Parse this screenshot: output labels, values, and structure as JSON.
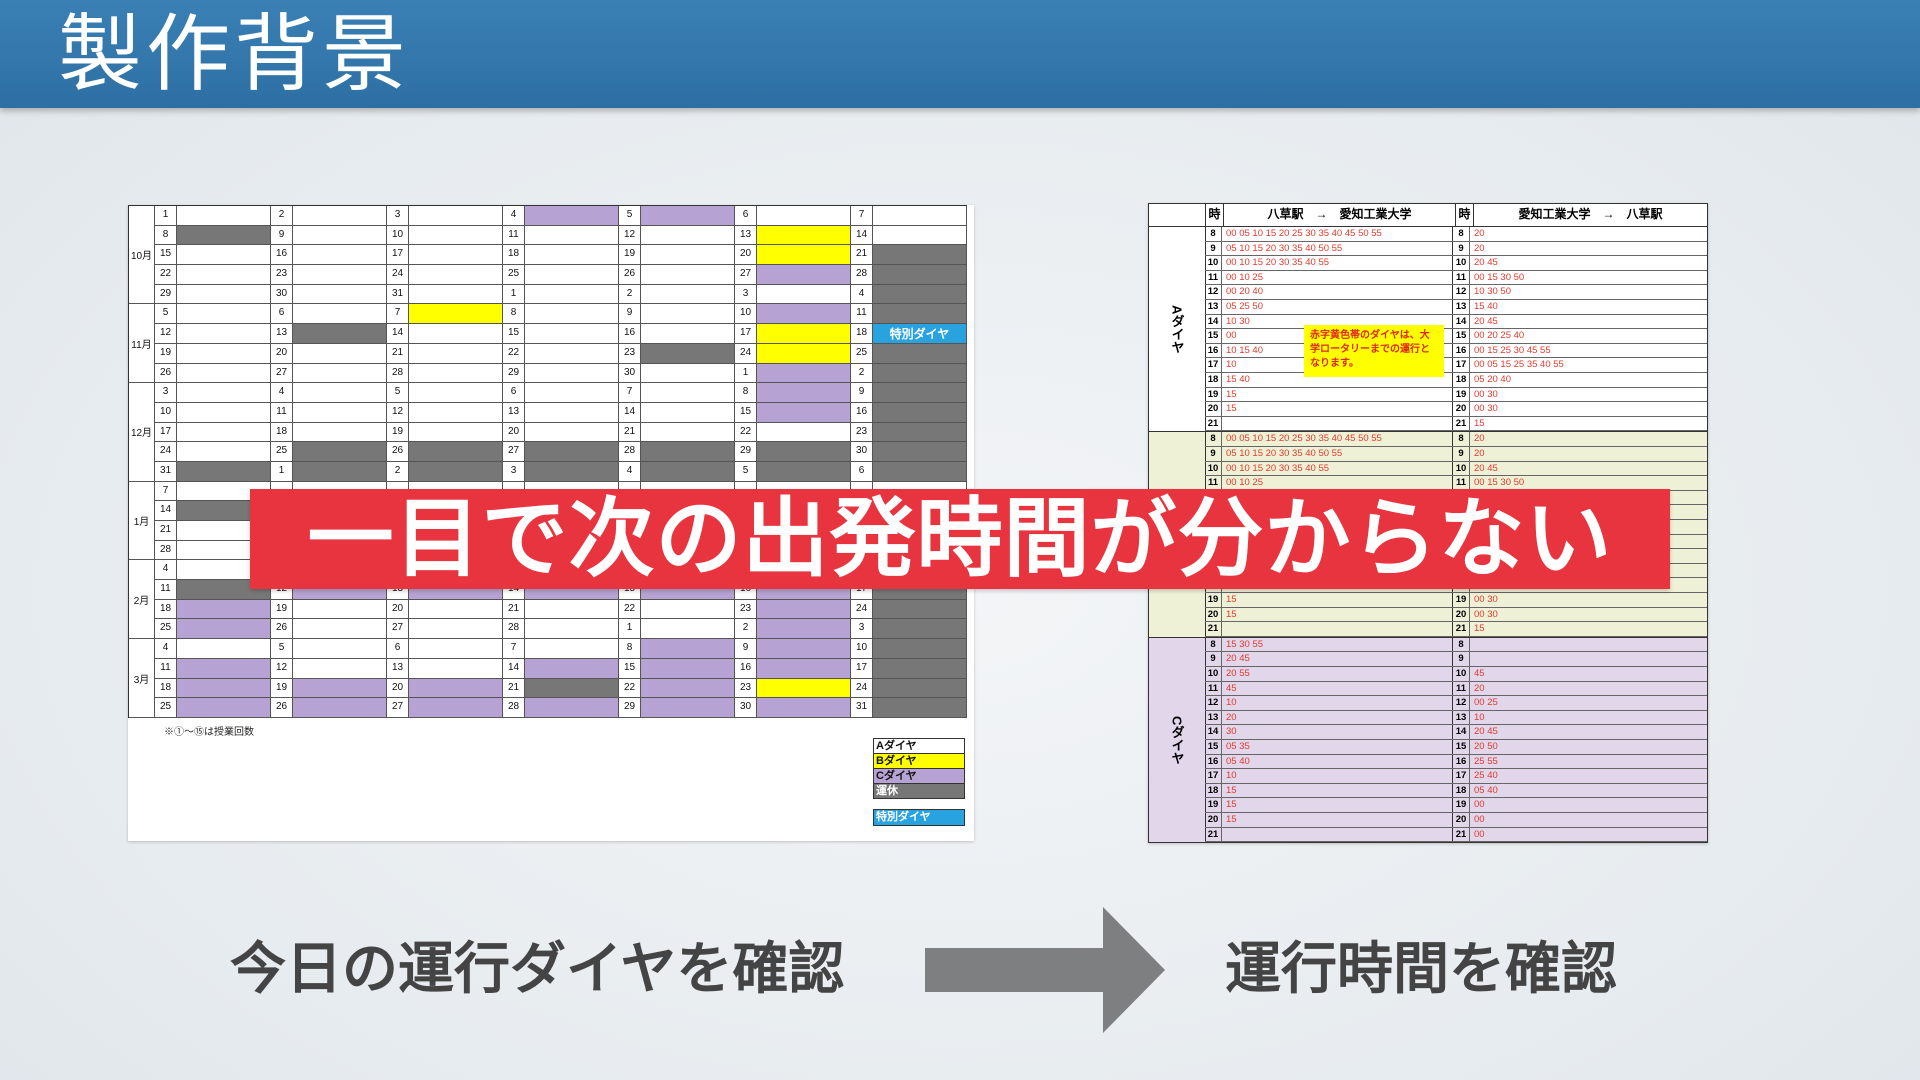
{
  "header": {
    "title": "製作背景"
  },
  "calendar": {
    "months": [
      {
        "label": "10月",
        "rows": [
          [
            [
              "1",
              "A"
            ],
            [
              "2",
              "A"
            ],
            [
              "3",
              "A"
            ],
            [
              "4",
              "C"
            ],
            [
              "5",
              "C"
            ],
            [
              "6",
              "A"
            ],
            [
              "7",
              "A"
            ]
          ],
          [
            [
              "8",
              "R"
            ],
            [
              "9",
              "A"
            ],
            [
              "10",
              "A"
            ],
            [
              "11",
              "A"
            ],
            [
              "12",
              "A"
            ],
            [
              "13",
              "B"
            ],
            [
              "14",
              "A"
            ]
          ],
          [
            [
              "15",
              "A"
            ],
            [
              "16",
              "A"
            ],
            [
              "17",
              "A"
            ],
            [
              "18",
              "A"
            ],
            [
              "19",
              "A"
            ],
            [
              "20",
              "B"
            ],
            [
              "21",
              "R"
            ]
          ],
          [
            [
              "22",
              "A"
            ],
            [
              "23",
              "A"
            ],
            [
              "24",
              "A"
            ],
            [
              "25",
              "A"
            ],
            [
              "26",
              "A"
            ],
            [
              "27",
              "C"
            ],
            [
              "28",
              "R"
            ]
          ],
          [
            [
              "29",
              "A"
            ],
            [
              "30",
              "A"
            ],
            [
              "31",
              "A"
            ],
            [
              "1",
              "A"
            ],
            [
              "2",
              "A"
            ],
            [
              "3",
              "A"
            ],
            [
              "4",
              "R"
            ]
          ]
        ]
      },
      {
        "label": "11月",
        "rows": [
          [
            [
              "5",
              "A"
            ],
            [
              "6",
              "A"
            ],
            [
              "7",
              "B"
            ],
            [
              "8",
              "A"
            ],
            [
              "9",
              "A"
            ],
            [
              "10",
              "C"
            ],
            [
              "11",
              "R"
            ]
          ],
          [
            [
              "12",
              "A"
            ],
            [
              "13",
              "R"
            ],
            [
              "14",
              "A"
            ],
            [
              "15",
              "A"
            ],
            [
              "16",
              "A"
            ],
            [
              "17",
              "B"
            ],
            [
              "18",
              "S"
            ]
          ],
          [
            [
              "19",
              "A"
            ],
            [
              "20",
              "A"
            ],
            [
              "21",
              "A"
            ],
            [
              "22",
              "A"
            ],
            [
              "23",
              "R"
            ],
            [
              "24",
              "B"
            ],
            [
              "25",
              "R"
            ]
          ],
          [
            [
              "26",
              "A"
            ],
            [
              "27",
              "A"
            ],
            [
              "28",
              "A"
            ],
            [
              "29",
              "A"
            ],
            [
              "30",
              "A"
            ],
            [
              "1",
              "C"
            ],
            [
              "2",
              "R"
            ]
          ]
        ]
      },
      {
        "label": "12月",
        "rows": [
          [
            [
              "3",
              "A"
            ],
            [
              "4",
              "A"
            ],
            [
              "5",
              "A"
            ],
            [
              "6",
              "A"
            ],
            [
              "7",
              "A"
            ],
            [
              "8",
              "C"
            ],
            [
              "9",
              "R"
            ]
          ],
          [
            [
              "10",
              "A"
            ],
            [
              "11",
              "A"
            ],
            [
              "12",
              "A"
            ],
            [
              "13",
              "A"
            ],
            [
              "14",
              "A"
            ],
            [
              "15",
              "C"
            ],
            [
              "16",
              "R"
            ]
          ],
          [
            [
              "17",
              "A"
            ],
            [
              "18",
              "A"
            ],
            [
              "19",
              "A"
            ],
            [
              "20",
              "A"
            ],
            [
              "21",
              "A"
            ],
            [
              "22",
              "A"
            ],
            [
              "23",
              "R"
            ]
          ],
          [
            [
              "24",
              "A"
            ],
            [
              "25",
              "R"
            ],
            [
              "26",
              "R"
            ],
            [
              "27",
              "R"
            ],
            [
              "28",
              "R"
            ],
            [
              "29",
              "R"
            ],
            [
              "30",
              "R"
            ]
          ],
          [
            [
              "31",
              "R"
            ],
            [
              "1",
              "R"
            ],
            [
              "2",
              "R"
            ],
            [
              "3",
              "R"
            ],
            [
              "4",
              "R"
            ],
            [
              "5",
              "R"
            ],
            [
              "6",
              "R"
            ]
          ]
        ]
      },
      {
        "label": "1月",
        "rows": [
          [
            [
              "7",
              "A"
            ],
            [
              "",
              "A"
            ],
            [
              "",
              "A"
            ],
            [
              "",
              "A"
            ],
            [
              "",
              "A"
            ],
            [
              "",
              "A"
            ],
            [
              "",
              "A"
            ]
          ],
          [
            [
              "14",
              "R"
            ],
            [
              "",
              "A"
            ],
            [
              "",
              "A"
            ],
            [
              "",
              "A"
            ],
            [
              "",
              "A"
            ],
            [
              "",
              "A"
            ],
            [
              "",
              "A"
            ]
          ],
          [
            [
              "21",
              "A"
            ],
            [
              "",
              "A"
            ],
            [
              "",
              "A"
            ],
            [
              "",
              "A"
            ],
            [
              "",
              "A"
            ],
            [
              "",
              "A"
            ],
            [
              "",
              "A"
            ]
          ],
          [
            [
              "28",
              "A"
            ],
            [
              "",
              "A"
            ],
            [
              "",
              "A"
            ],
            [
              "",
              "A"
            ],
            [
              "",
              "A"
            ],
            [
              "",
              "A"
            ],
            [
              "",
              "A"
            ]
          ]
        ]
      },
      {
        "label": "2月",
        "rows": [
          [
            [
              "4",
              "A"
            ],
            [
              "",
              "A"
            ],
            [
              "",
              "A"
            ],
            [
              "",
              "A"
            ],
            [
              "",
              "A"
            ],
            [
              "",
              "A"
            ],
            [
              "",
              "A"
            ]
          ],
          [
            [
              "11",
              "R"
            ],
            [
              "12",
              "C"
            ],
            [
              "13",
              "C"
            ],
            [
              "14",
              "C"
            ],
            [
              "15",
              "C"
            ],
            [
              "16",
              "C"
            ],
            [
              "17",
              "R"
            ]
          ],
          [
            [
              "18",
              "C"
            ],
            [
              "19",
              "A"
            ],
            [
              "20",
              "A"
            ],
            [
              "21",
              "A"
            ],
            [
              "22",
              "A"
            ],
            [
              "23",
              "C"
            ],
            [
              "24",
              "R"
            ]
          ],
          [
            [
              "25",
              "C"
            ],
            [
              "26",
              "A"
            ],
            [
              "27",
              "A"
            ],
            [
              "28",
              "A"
            ],
            [
              "1",
              "A"
            ],
            [
              "2",
              "C"
            ],
            [
              "3",
              "R"
            ]
          ]
        ]
      },
      {
        "label": "3月",
        "rows": [
          [
            [
              "4",
              "A"
            ],
            [
              "5",
              "A"
            ],
            [
              "6",
              "A"
            ],
            [
              "7",
              "A"
            ],
            [
              "8",
              "C"
            ],
            [
              "9",
              "C"
            ],
            [
              "10",
              "R"
            ]
          ],
          [
            [
              "11",
              "C"
            ],
            [
              "12",
              "A"
            ],
            [
              "13",
              "A"
            ],
            [
              "14",
              "C"
            ],
            [
              "15",
              "C"
            ],
            [
              "16",
              "C"
            ],
            [
              "17",
              "R"
            ]
          ],
          [
            [
              "18",
              "C"
            ],
            [
              "19",
              "C"
            ],
            [
              "20",
              "C"
            ],
            [
              "21",
              "R"
            ],
            [
              "22",
              "C"
            ],
            [
              "23",
              "B"
            ],
            [
              "24",
              "R"
            ]
          ],
          [
            [
              "25",
              "C"
            ],
            [
              "26",
              "C"
            ],
            [
              "27",
              "C"
            ],
            [
              "28",
              "C"
            ],
            [
              "29",
              "C"
            ],
            [
              "30",
              "C"
            ],
            [
              "31",
              "R"
            ]
          ]
        ]
      }
    ],
    "special_label": "特別ダイヤ",
    "note": "※①〜⑮は授業回数",
    "legend": {
      "a": "Aダイヤ",
      "b": "Bダイヤ",
      "c": "Cダイヤ",
      "off": "運休",
      "special": "特別ダイヤ"
    }
  },
  "timetable": {
    "header": {
      "hour": "時",
      "dir1": "八草駅　→　愛知工業大学",
      "dir2": "愛知工業大学　→　八草駅"
    },
    "sections": [
      {
        "label": "Aダイヤ",
        "rows": [
          [
            "8",
            "00 05 10 15 20 25 30 35 40 45 50 55",
            "8",
            "20"
          ],
          [
            "9",
            "05 10 15 20 30 35 40 50 55",
            "9",
            "20"
          ],
          [
            "10",
            "00 10 15 20 30 35 40 55",
            "10",
            "20 45"
          ],
          [
            "11",
            "00 10 25",
            "11",
            "00 15 30 50"
          ],
          [
            "12",
            "00 20 40",
            "12",
            "10 30 50"
          ],
          [
            "13",
            "05 25 50",
            "13",
            "15 40"
          ],
          [
            "14",
            "10 30",
            "14",
            "20 45"
          ],
          [
            "15",
            "00",
            "15",
            "00 20 25 40"
          ],
          [
            "16",
            "10 15 40",
            "16",
            "00 15 25 30 45 55"
          ],
          [
            "17",
            "10",
            "17",
            "00 05 15 25 35 40 55"
          ],
          [
            "18",
            "15 40",
            "18",
            "05 20 40"
          ],
          [
            "19",
            "15",
            "19",
            "00 30"
          ],
          [
            "20",
            "15",
            "20",
            "00 30"
          ],
          [
            "21",
            "",
            "21",
            "15"
          ]
        ]
      },
      {
        "label": "",
        "rows": [
          [
            "8",
            "00 05 10 15 20 25 30 35 40 45 50 55",
            "8",
            "20"
          ],
          [
            "9",
            "05 10 15 20 30 35 40 50 55",
            "9",
            "20"
          ],
          [
            "10",
            "00 10 15 20 30 35 40 55",
            "10",
            "20 45"
          ],
          [
            "11",
            "00 10 25",
            "11",
            "00 15 30 50"
          ],
          [
            "",
            "",
            "",
            ""
          ],
          [
            "",
            "",
            "",
            ""
          ],
          [
            "",
            "",
            "",
            ""
          ],
          [
            "",
            "",
            "",
            ""
          ],
          [
            "",
            "",
            "",
            ""
          ],
          [
            "",
            "",
            "",
            ""
          ],
          [
            "",
            "",
            "",
            ""
          ],
          [
            "19",
            "15",
            "19",
            "00 30"
          ],
          [
            "20",
            "15",
            "20",
            "00 30"
          ],
          [
            "21",
            "",
            "21",
            "15"
          ]
        ]
      },
      {
        "label": "Cダイヤ",
        "rows": [
          [
            "8",
            "15 30 55",
            "8",
            ""
          ],
          [
            "9",
            "20 45",
            "9",
            ""
          ],
          [
            "10",
            "20 55",
            "10",
            "45"
          ],
          [
            "11",
            "45",
            "11",
            "20"
          ],
          [
            "12",
            "10",
            "12",
            "00 25"
          ],
          [
            "13",
            "20",
            "13",
            "10"
          ],
          [
            "14",
            "30",
            "14",
            "20 45"
          ],
          [
            "15",
            "05 35",
            "15",
            "20 50"
          ],
          [
            "16",
            "05 40",
            "16",
            "25 55"
          ],
          [
            "17",
            "10",
            "17",
            "25 40"
          ],
          [
            "18",
            "15",
            "18",
            "05 40"
          ],
          [
            "19",
            "15",
            "19",
            "00"
          ],
          [
            "20",
            "15",
            "20",
            "00"
          ],
          [
            "21",
            "",
            "21",
            "00"
          ]
        ]
      }
    ],
    "note": "赤字黄色帯のダイヤは、大学ロータリーまでの運行となります。"
  },
  "banner": {
    "text": "一目で次の出発時間が分からない"
  },
  "captions": {
    "left": "今日の運行ダイヤを確認",
    "right": "運行時間を確認"
  }
}
